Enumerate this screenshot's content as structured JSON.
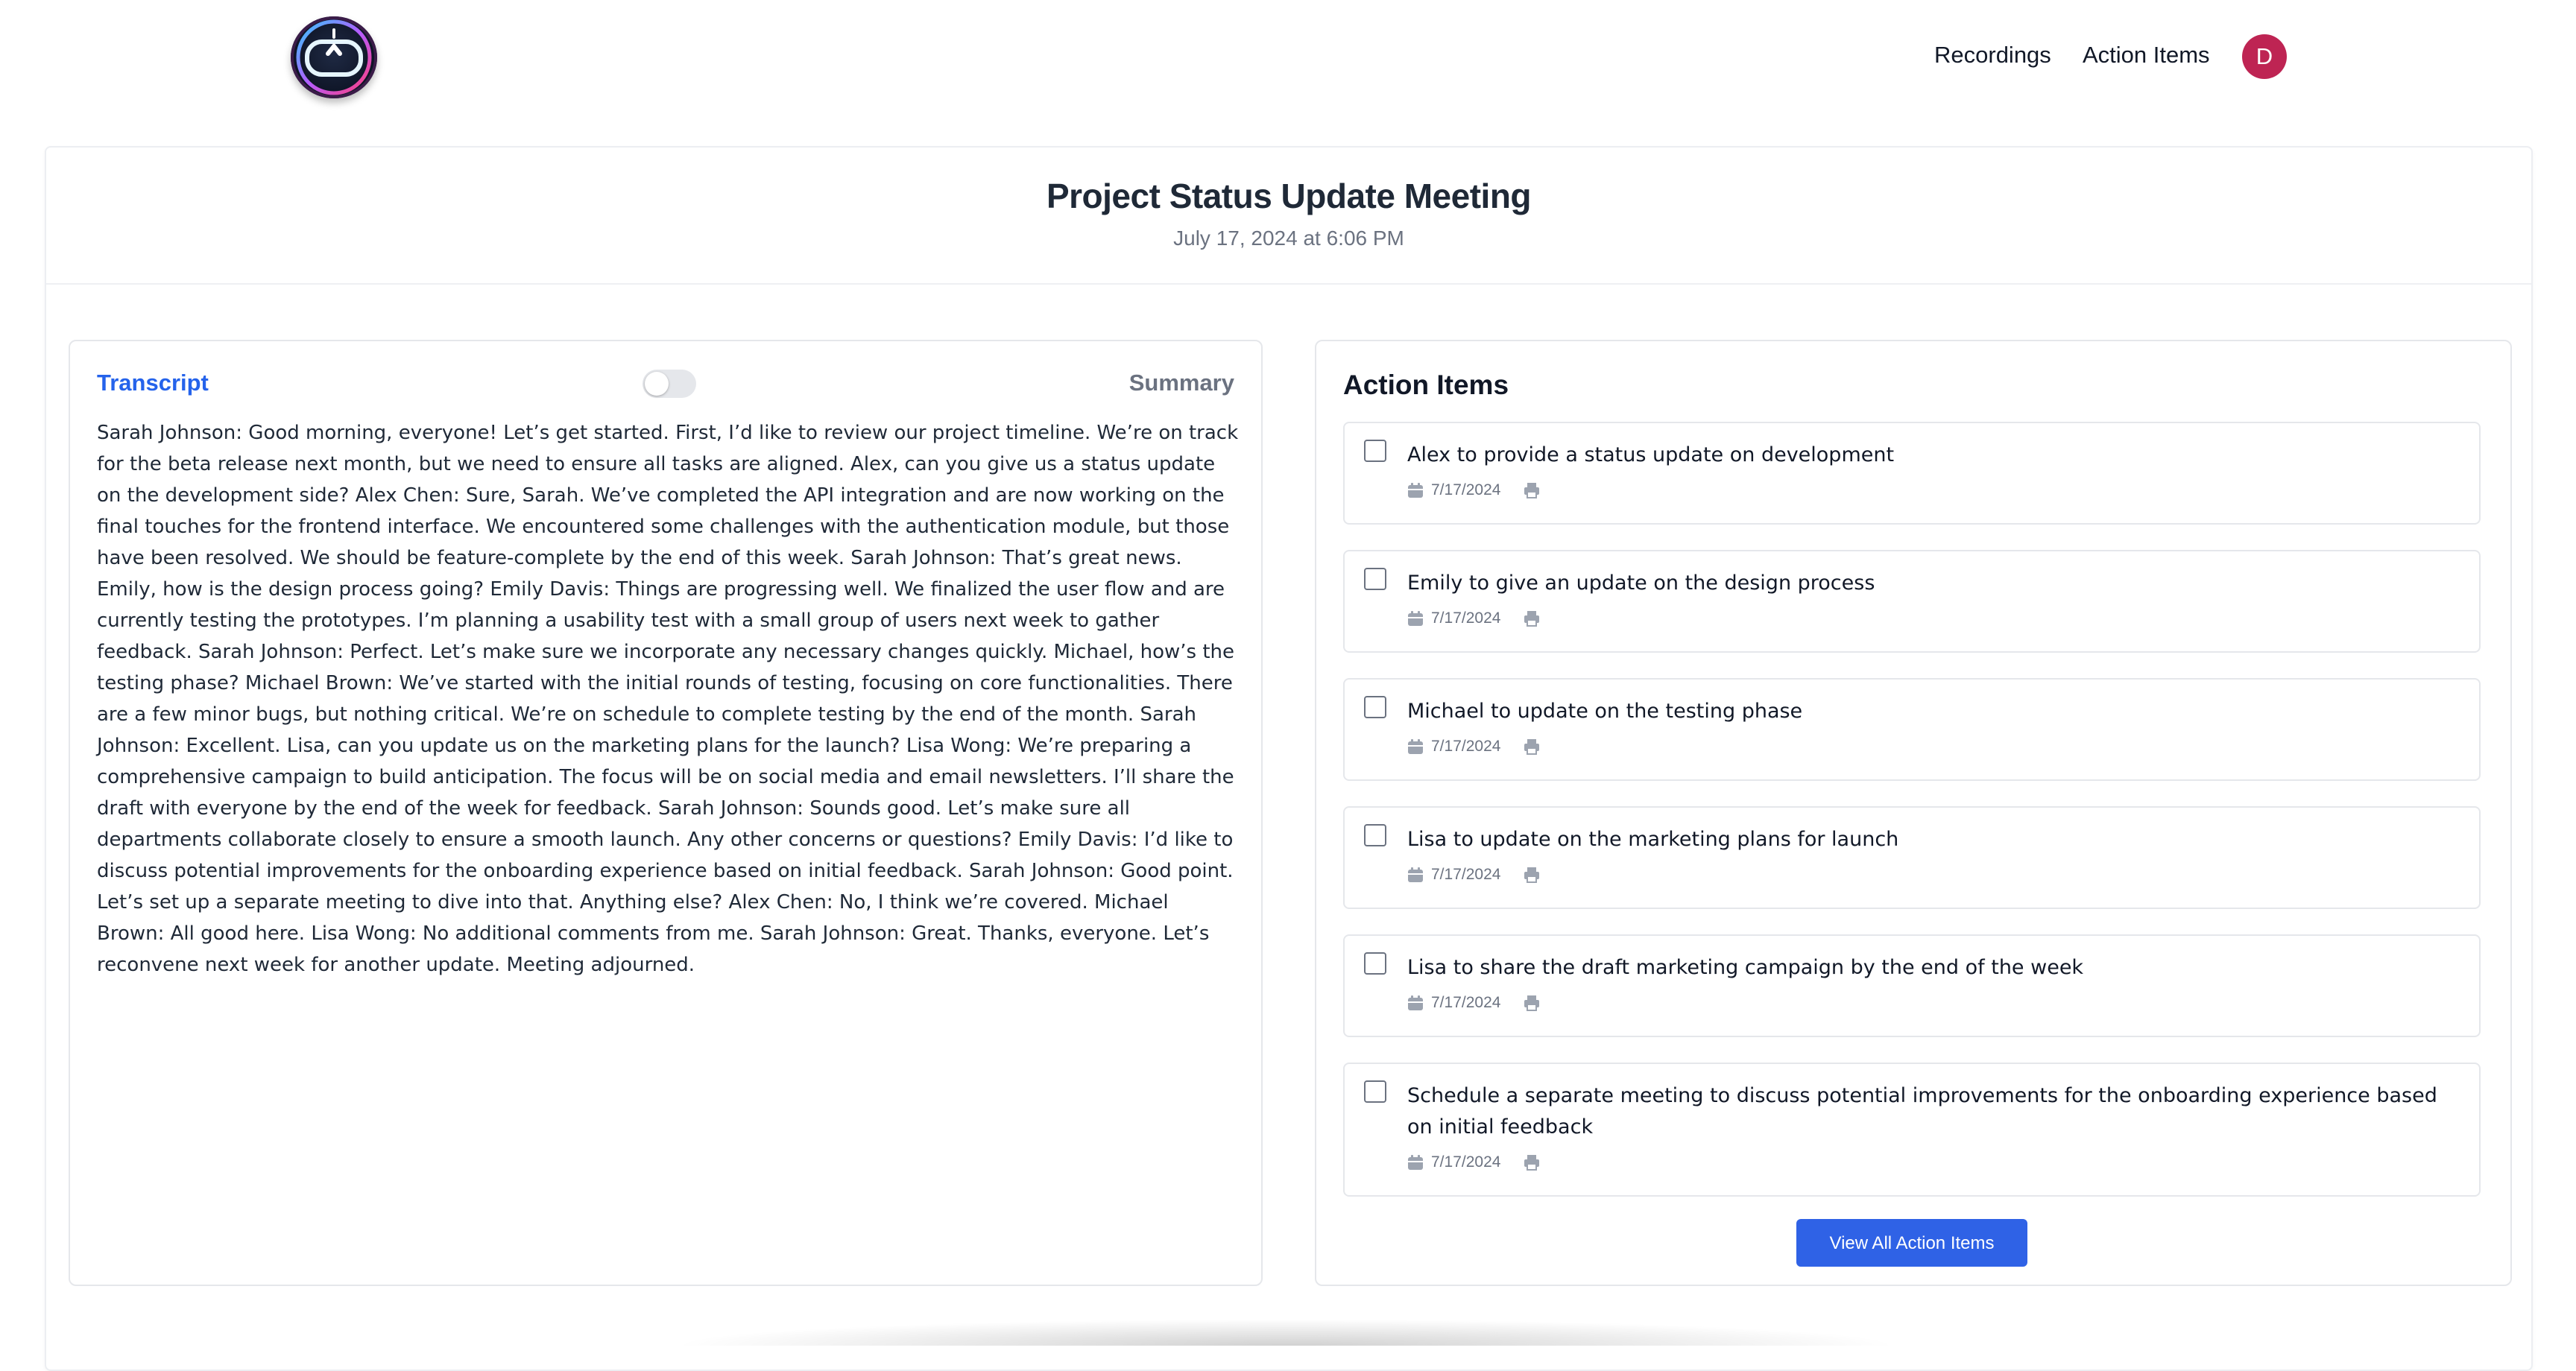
{
  "nav": {
    "links": [
      "Recordings",
      "Action Items"
    ],
    "avatar_initial": "D"
  },
  "meeting": {
    "title": "Project Status Update Meeting",
    "datetime": "July 17, 2024 at 6:06 PM"
  },
  "transcript_panel": {
    "tab_transcript": "Transcript",
    "tab_summary": "Summary",
    "toggle_on": false,
    "text": "Sarah Johnson: Good morning, everyone! Let’s get started. First, I’d like to review our project timeline. We’re on track for the beta release next month, but we need to ensure all tasks are aligned. Alex, can you give us a status update on the development side? Alex Chen: Sure, Sarah. We’ve completed the API integration and are now working on the final touches for the frontend interface. We encountered some challenges with the authentication module, but those have been resolved. We should be feature-complete by the end of this week. Sarah Johnson: That’s great news. Emily, how is the design process going? Emily Davis: Things are progressing well. We finalized the user flow and are currently testing the prototypes. I’m planning a usability test with a small group of users next week to gather feedback. Sarah Johnson: Perfect. Let’s make sure we incorporate any necessary changes quickly. Michael, how’s the testing phase? Michael Brown: We’ve started with the initial rounds of testing, focusing on core functionalities. There are a few minor bugs, but nothing critical. We’re on schedule to complete testing by the end of the month. Sarah Johnson: Excellent. Lisa, can you update us on the marketing plans for the launch? Lisa Wong: We’re preparing a comprehensive campaign to build anticipation. The focus will be on social media and email newsletters. I’ll share the draft with everyone by the end of the week for feedback. Sarah Johnson: Sounds good. Let’s make sure all departments collaborate closely to ensure a smooth launch. Any other concerns or questions? Emily Davis: I’d like to discuss potential improvements for the onboarding experience based on initial feedback. Sarah Johnson: Good point. Let’s set up a separate meeting to dive into that. Anything else? Alex Chen: No, I think we’re covered. Michael Brown: All good here. Lisa Wong: No additional comments from me. Sarah Johnson: Great. Thanks, everyone. Let’s reconvene next week for another update. Meeting adjourned."
  },
  "action_items": {
    "heading": "Action Items",
    "items": [
      {
        "text": "Alex to provide a status update on development",
        "date": "7/17/2024",
        "checked": false
      },
      {
        "text": "Emily to give an update on the design process",
        "date": "7/17/2024",
        "checked": false
      },
      {
        "text": "Michael to update on the testing phase",
        "date": "7/17/2024",
        "checked": false
      },
      {
        "text": "Lisa to update on the marketing plans for launch",
        "date": "7/17/2024",
        "checked": false
      },
      {
        "text": "Lisa to share the draft marketing campaign by the end of the week",
        "date": "7/17/2024",
        "checked": false
      },
      {
        "text": "Schedule a separate meeting to discuss potential improvements for the onboarding experience based on initial feedback",
        "date": "7/17/2024",
        "checked": false
      }
    ],
    "view_all_label": "View All Action Items",
    "icons": {
      "date": "calendar-icon",
      "print": "printer-icon"
    }
  },
  "colors": {
    "accent": "#2563eb",
    "button": "#2f62e6",
    "avatar": "#be2453"
  }
}
